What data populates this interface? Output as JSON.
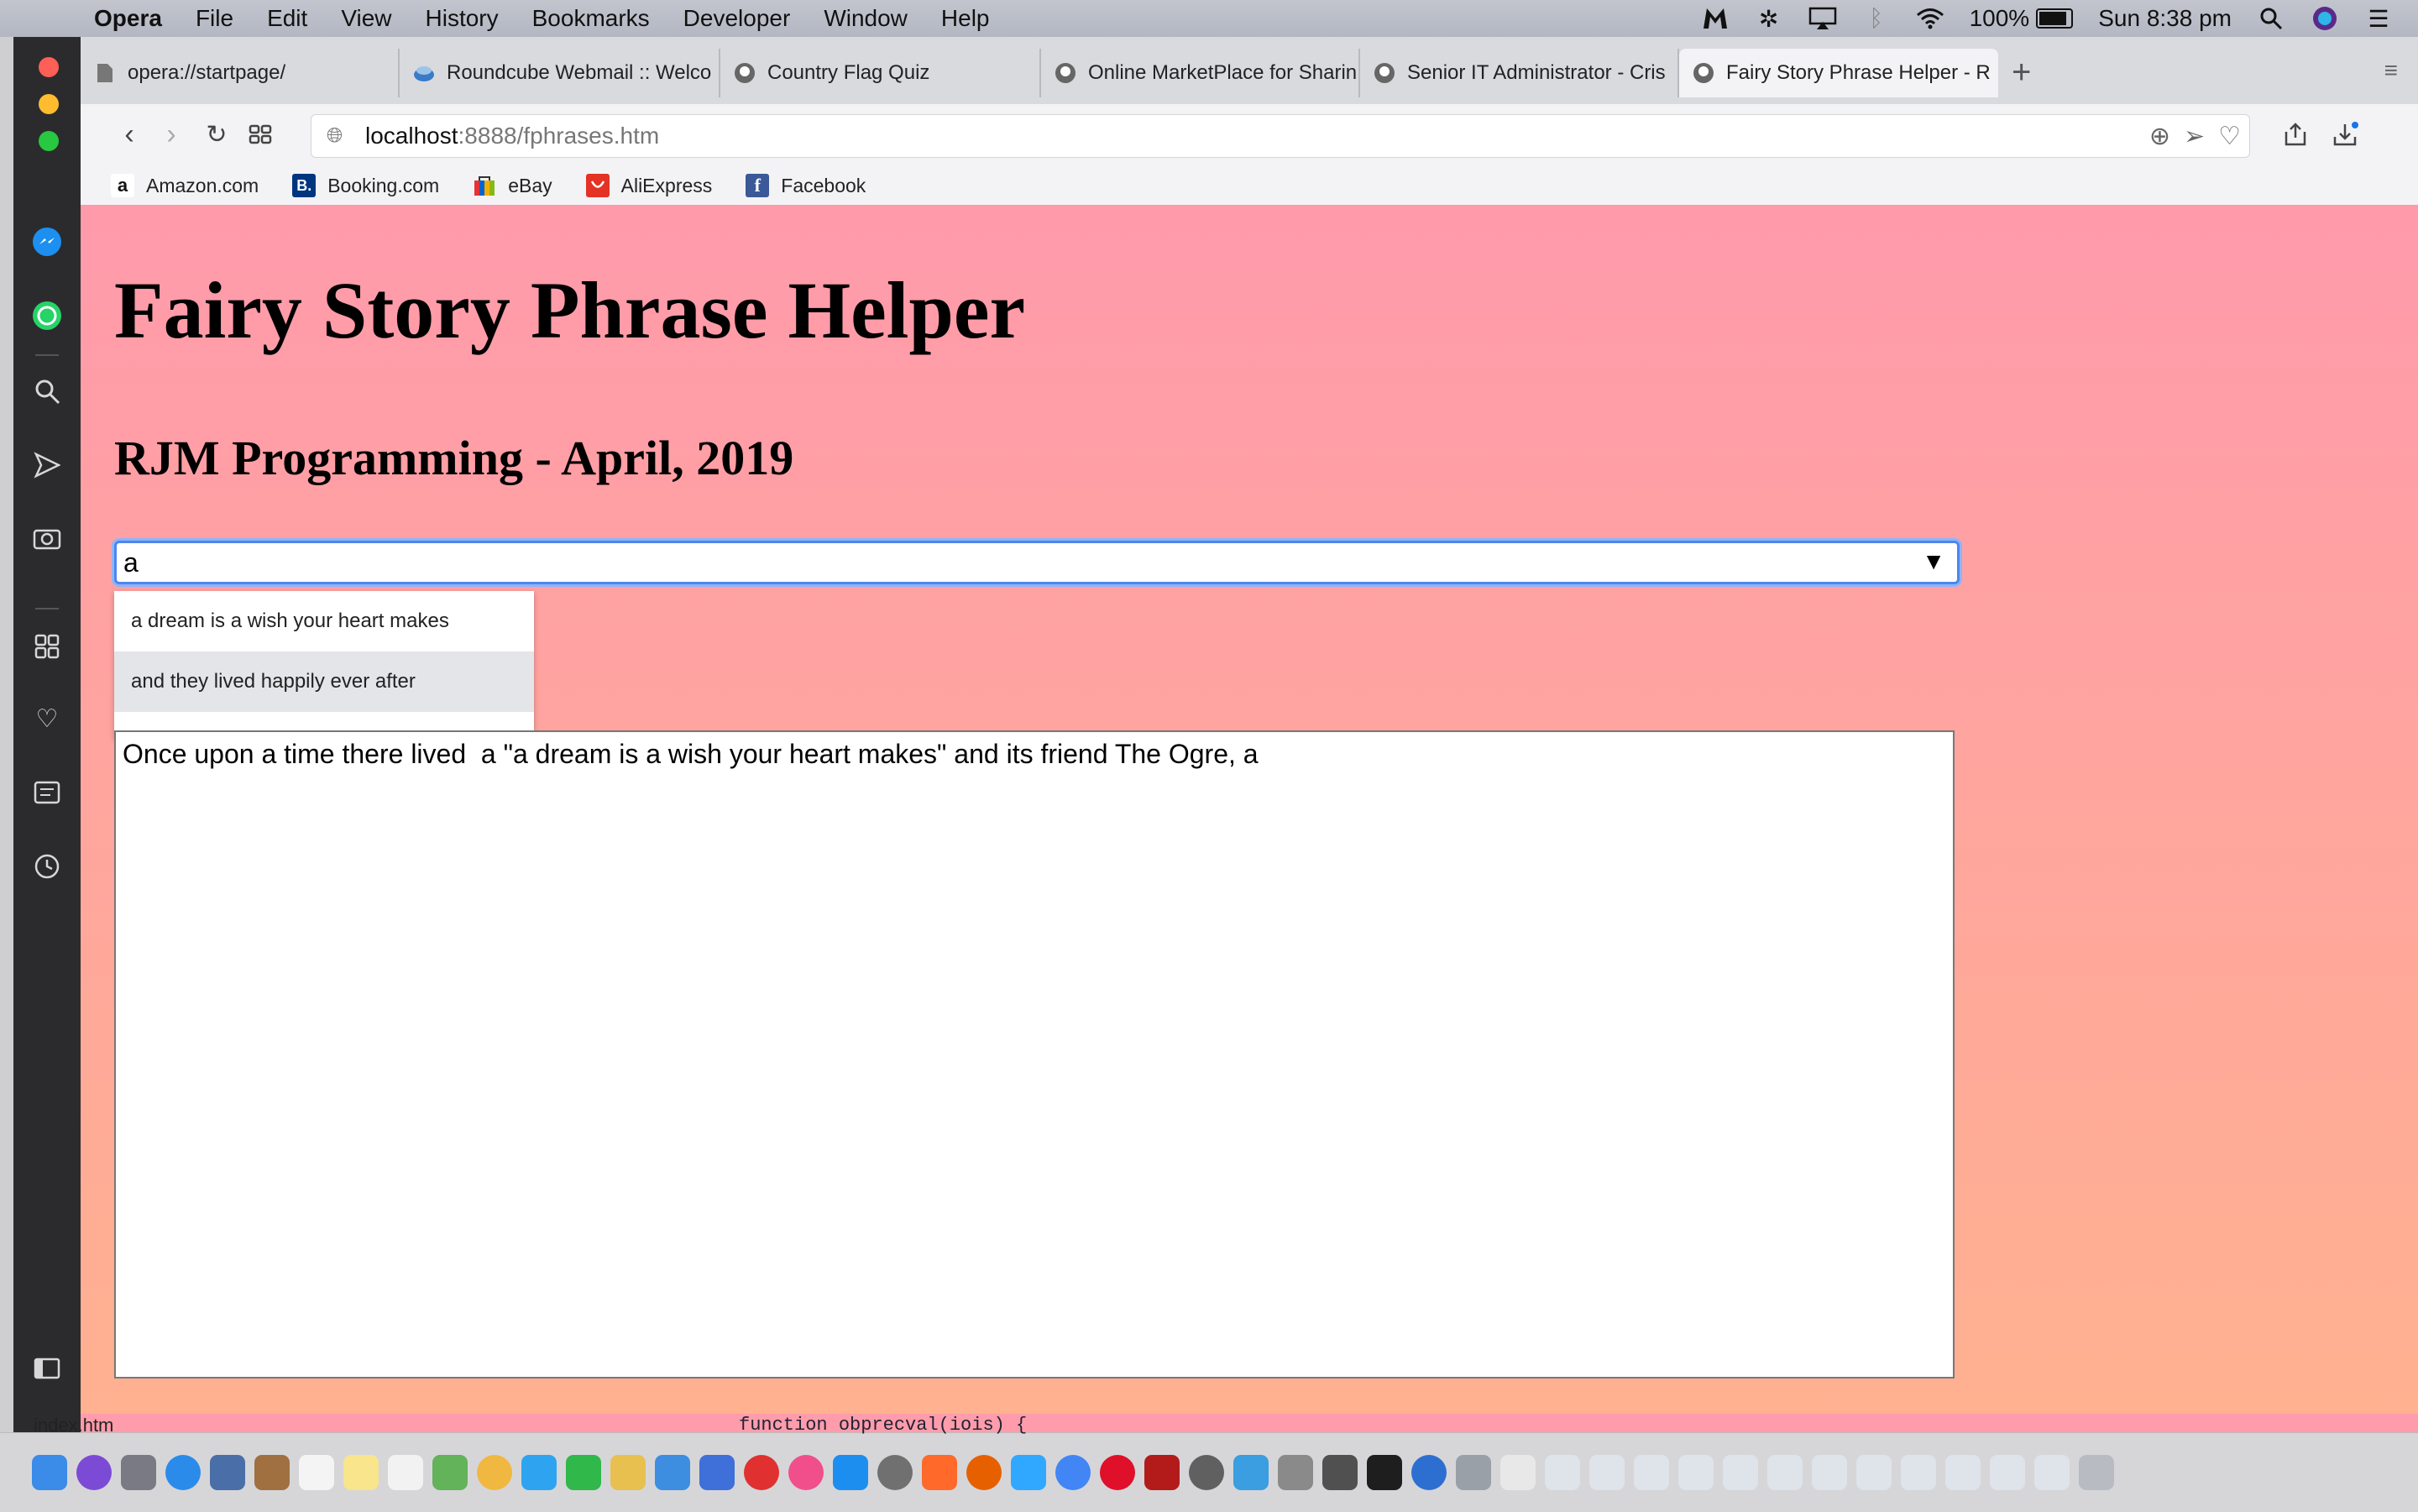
{
  "menubar": {
    "app": "Opera",
    "items": [
      "File",
      "Edit",
      "View",
      "History",
      "Bookmarks",
      "Developer",
      "Window",
      "Help"
    ],
    "battery": "100%",
    "clock": "Sun 8:38 pm"
  },
  "tabs": [
    {
      "label": "opera://startpage/"
    },
    {
      "label": "Roundcube Webmail :: Welco"
    },
    {
      "label": "Country Flag Quiz"
    },
    {
      "label": "Online MarketPlace for Sharin"
    },
    {
      "label": "Senior IT Administrator - Cris"
    },
    {
      "label": "Fairy Story Phrase Helper - R"
    }
  ],
  "address": {
    "host": "localhost",
    "path": ":8888/fphrases.htm"
  },
  "bookmarks": [
    {
      "label": "Amazon.com",
      "glyph": "a"
    },
    {
      "label": "Booking.com",
      "glyph": "B."
    },
    {
      "label": "eBay",
      "glyph": ""
    },
    {
      "label": "AliExpress",
      "glyph": ""
    },
    {
      "label": "Facebook",
      "glyph": "f"
    }
  ],
  "page": {
    "title": "Fairy Story Phrase Helper",
    "subtitle": "RJM Programming - April, 2019",
    "phrase_input_value": "a",
    "suggestions": [
      "a dream is a wish your heart makes",
      "and they lived happily ever after"
    ],
    "story_text": "Once upon a time there lived  a \"a dream is a wish your heart makes\" and its friend The Ogre, a"
  },
  "dock": {
    "behind_window_label": "index.htm",
    "behind_code_snippet": "function obprecval(iois) {"
  },
  "colors": {
    "page_top": "#ff9aab",
    "page_bottom": "#ffb190",
    "focus_ring": "#4d86f0"
  }
}
